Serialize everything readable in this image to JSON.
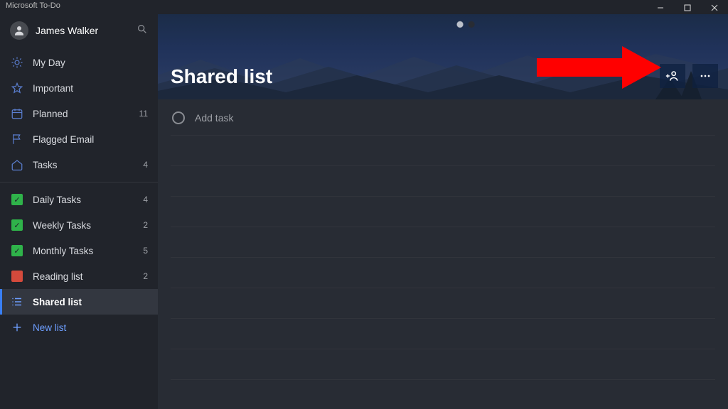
{
  "app_title": "Microsoft To-Do",
  "user": {
    "name": "James Walker"
  },
  "smart_lists": [
    {
      "label": "My Day",
      "count": ""
    },
    {
      "label": "Important",
      "count": ""
    },
    {
      "label": "Planned",
      "count": "11"
    },
    {
      "label": "Flagged Email",
      "count": ""
    },
    {
      "label": "Tasks",
      "count": "4"
    }
  ],
  "custom_lists": [
    {
      "label": "Daily Tasks",
      "count": "4"
    },
    {
      "label": "Weekly Tasks",
      "count": "2"
    },
    {
      "label": "Monthly Tasks",
      "count": "5"
    },
    {
      "label": "Reading list",
      "count": "2"
    },
    {
      "label": "Shared list",
      "count": ""
    }
  ],
  "new_list_label": "New list",
  "main": {
    "title": "Shared list",
    "add_task_placeholder": "Add task"
  }
}
